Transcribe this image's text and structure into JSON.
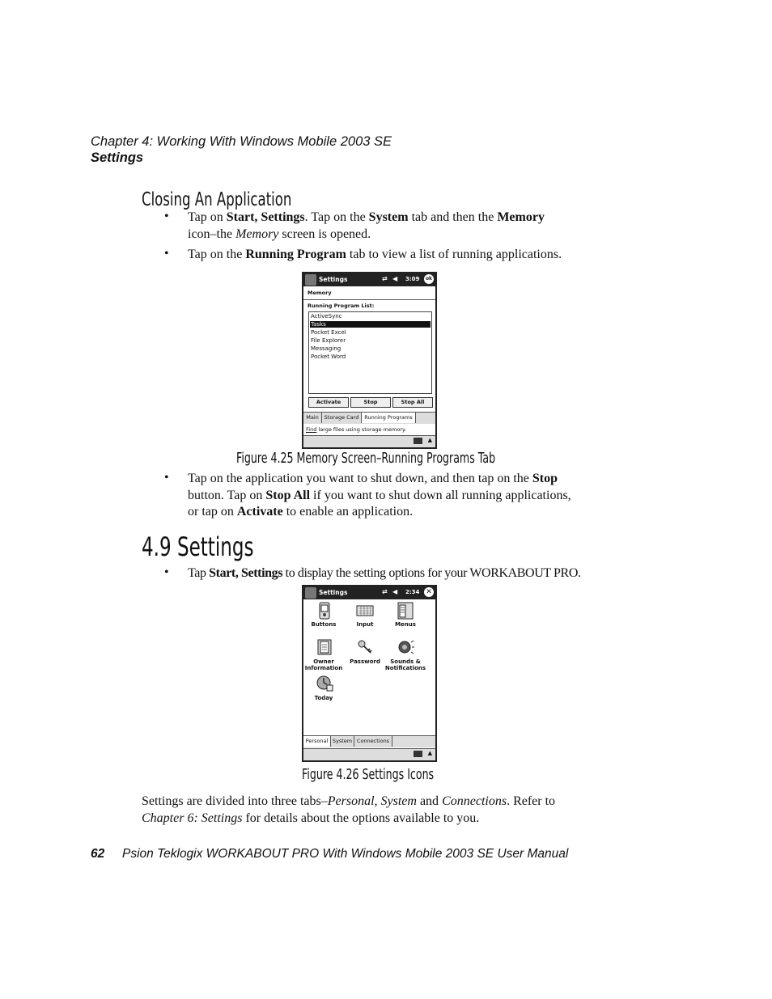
{
  "header": {
    "chapter_line": "Chapter  4:  Working With Windows Mobile 2003 SE",
    "section_line": "Settings"
  },
  "closing": {
    "title": "Closing An Application",
    "bullet1_parts": [
      "Tap on ",
      "Start, Settings",
      ". Tap on the ",
      "System",
      " tab and then the ",
      "Memory"
    ],
    "bullet1_line2_parts": [
      "icon",
      "–",
      "the ",
      "Memory",
      " screen is opened."
    ],
    "bullet2_parts": [
      "Tap on the ",
      "Running Program",
      " tab to view a list of running applications."
    ]
  },
  "memory_screen": {
    "title": "Settings",
    "time": "3:09",
    "ok": "ok",
    "heading": "Memory",
    "list_label": "Running Program List:",
    "items": [
      "ActiveSync",
      "Tasks",
      "Pocket Excel",
      "File Explorer",
      "Messaging",
      "Pocket Word"
    ],
    "selected_index": 1,
    "buttons": [
      "Activate",
      "Stop",
      "Stop All"
    ],
    "tabs": [
      "Main",
      "Storage Card",
      "Running Programs"
    ],
    "active_tab": 2,
    "status_link": "Find",
    "status_text": " large files using storage memory."
  },
  "figure_425_caption": "Figure 4.25 Memory Screen–Running Programs Tab",
  "after_bullet": {
    "line1_parts": [
      "Tap on the application you want to shut down, and then tap on the ",
      "Stop"
    ],
    "line2_parts": [
      "button. Tap on ",
      "Stop All",
      " if you want to shut down all running applications,"
    ],
    "line3_parts": [
      "or tap on ",
      "Activate",
      " to enable an application."
    ]
  },
  "section_49": {
    "title": "4.9  Settings",
    "bullet_parts": [
      "Tap ",
      "Start, Settings",
      " to display the setting options for your WORKABOUT PRO."
    ]
  },
  "settings_screen": {
    "title": "Settings",
    "time": "2:34",
    "icons": [
      {
        "name": "Buttons",
        "icon": "buttons-icon"
      },
      {
        "name": "Input",
        "icon": "keyboard-icon"
      },
      {
        "name": "Menus",
        "icon": "menus-icon"
      },
      {
        "name": "Owner Information",
        "icon": "owner-info-icon"
      },
      {
        "name": "Password",
        "icon": "keys-icon"
      },
      {
        "name": "Sounds & Notifications",
        "icon": "speaker-icon"
      },
      {
        "name": "Today",
        "icon": "today-icon"
      }
    ],
    "label_lines": {
      "owner1": "Owner",
      "owner2": "Information",
      "sounds1": "Sounds &",
      "sounds2": "Notifications"
    },
    "tabs": [
      "Personal",
      "System",
      "Connections"
    ],
    "active_tab": 0
  },
  "figure_426_caption": "Figure 4.26 Settings Icons",
  "closing_paragraph": {
    "line1_parts": [
      "Settings are divided into three tabs",
      "–",
      "Personal",
      ", ",
      "System",
      " and ",
      "Connections",
      ". Refer to"
    ],
    "line2_parts": [
      "Chapter 6: Settings",
      " for details about the options available to you."
    ]
  },
  "footer": {
    "page_number": "62",
    "manual_title": "Psion Teklogix WORKABOUT PRO With Windows Mobile 2003 SE User Manual"
  }
}
